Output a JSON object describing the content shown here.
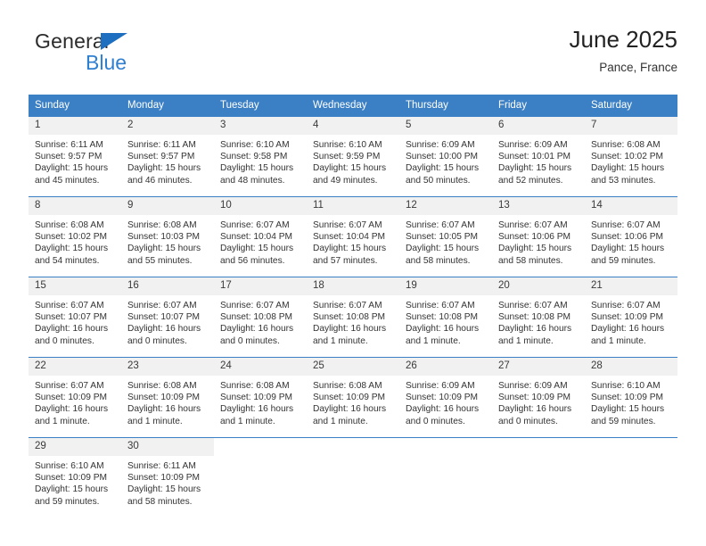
{
  "brand": {
    "name_part1": "General",
    "name_part2": "Blue",
    "triangle_color": "#1f6fc0",
    "blue_color": "#2f7fd1"
  },
  "header": {
    "title": "June 2025",
    "subtitle": "Pance, France"
  },
  "theme": {
    "header_row_bg": "#3b7fc4",
    "daynum_bg": "#f1f1f1",
    "cell_border": "#3b7fc4",
    "text": "#333333"
  },
  "calendar": {
    "weekday_headers": [
      "Sunday",
      "Monday",
      "Tuesday",
      "Wednesday",
      "Thursday",
      "Friday",
      "Saturday"
    ],
    "weeks": [
      [
        {
          "day": "1",
          "sunrise": "Sunrise: 6:11 AM",
          "sunset": "Sunset: 9:57 PM",
          "daylight": "Daylight: 15 hours and 45 minutes."
        },
        {
          "day": "2",
          "sunrise": "Sunrise: 6:11 AM",
          "sunset": "Sunset: 9:57 PM",
          "daylight": "Daylight: 15 hours and 46 minutes."
        },
        {
          "day": "3",
          "sunrise": "Sunrise: 6:10 AM",
          "sunset": "Sunset: 9:58 PM",
          "daylight": "Daylight: 15 hours and 48 minutes."
        },
        {
          "day": "4",
          "sunrise": "Sunrise: 6:10 AM",
          "sunset": "Sunset: 9:59 PM",
          "daylight": "Daylight: 15 hours and 49 minutes."
        },
        {
          "day": "5",
          "sunrise": "Sunrise: 6:09 AM",
          "sunset": "Sunset: 10:00 PM",
          "daylight": "Daylight: 15 hours and 50 minutes."
        },
        {
          "day": "6",
          "sunrise": "Sunrise: 6:09 AM",
          "sunset": "Sunset: 10:01 PM",
          "daylight": "Daylight: 15 hours and 52 minutes."
        },
        {
          "day": "7",
          "sunrise": "Sunrise: 6:08 AM",
          "sunset": "Sunset: 10:02 PM",
          "daylight": "Daylight: 15 hours and 53 minutes."
        }
      ],
      [
        {
          "day": "8",
          "sunrise": "Sunrise: 6:08 AM",
          "sunset": "Sunset: 10:02 PM",
          "daylight": "Daylight: 15 hours and 54 minutes."
        },
        {
          "day": "9",
          "sunrise": "Sunrise: 6:08 AM",
          "sunset": "Sunset: 10:03 PM",
          "daylight": "Daylight: 15 hours and 55 minutes."
        },
        {
          "day": "10",
          "sunrise": "Sunrise: 6:07 AM",
          "sunset": "Sunset: 10:04 PM",
          "daylight": "Daylight: 15 hours and 56 minutes."
        },
        {
          "day": "11",
          "sunrise": "Sunrise: 6:07 AM",
          "sunset": "Sunset: 10:04 PM",
          "daylight": "Daylight: 15 hours and 57 minutes."
        },
        {
          "day": "12",
          "sunrise": "Sunrise: 6:07 AM",
          "sunset": "Sunset: 10:05 PM",
          "daylight": "Daylight: 15 hours and 58 minutes."
        },
        {
          "day": "13",
          "sunrise": "Sunrise: 6:07 AM",
          "sunset": "Sunset: 10:06 PM",
          "daylight": "Daylight: 15 hours and 58 minutes."
        },
        {
          "day": "14",
          "sunrise": "Sunrise: 6:07 AM",
          "sunset": "Sunset: 10:06 PM",
          "daylight": "Daylight: 15 hours and 59 minutes."
        }
      ],
      [
        {
          "day": "15",
          "sunrise": "Sunrise: 6:07 AM",
          "sunset": "Sunset: 10:07 PM",
          "daylight": "Daylight: 16 hours and 0 minutes."
        },
        {
          "day": "16",
          "sunrise": "Sunrise: 6:07 AM",
          "sunset": "Sunset: 10:07 PM",
          "daylight": "Daylight: 16 hours and 0 minutes."
        },
        {
          "day": "17",
          "sunrise": "Sunrise: 6:07 AM",
          "sunset": "Sunset: 10:08 PM",
          "daylight": "Daylight: 16 hours and 0 minutes."
        },
        {
          "day": "18",
          "sunrise": "Sunrise: 6:07 AM",
          "sunset": "Sunset: 10:08 PM",
          "daylight": "Daylight: 16 hours and 1 minute."
        },
        {
          "day": "19",
          "sunrise": "Sunrise: 6:07 AM",
          "sunset": "Sunset: 10:08 PM",
          "daylight": "Daylight: 16 hours and 1 minute."
        },
        {
          "day": "20",
          "sunrise": "Sunrise: 6:07 AM",
          "sunset": "Sunset: 10:08 PM",
          "daylight": "Daylight: 16 hours and 1 minute."
        },
        {
          "day": "21",
          "sunrise": "Sunrise: 6:07 AM",
          "sunset": "Sunset: 10:09 PM",
          "daylight": "Daylight: 16 hours and 1 minute."
        }
      ],
      [
        {
          "day": "22",
          "sunrise": "Sunrise: 6:07 AM",
          "sunset": "Sunset: 10:09 PM",
          "daylight": "Daylight: 16 hours and 1 minute."
        },
        {
          "day": "23",
          "sunrise": "Sunrise: 6:08 AM",
          "sunset": "Sunset: 10:09 PM",
          "daylight": "Daylight: 16 hours and 1 minute."
        },
        {
          "day": "24",
          "sunrise": "Sunrise: 6:08 AM",
          "sunset": "Sunset: 10:09 PM",
          "daylight": "Daylight: 16 hours and 1 minute."
        },
        {
          "day": "25",
          "sunrise": "Sunrise: 6:08 AM",
          "sunset": "Sunset: 10:09 PM",
          "daylight": "Daylight: 16 hours and 1 minute."
        },
        {
          "day": "26",
          "sunrise": "Sunrise: 6:09 AM",
          "sunset": "Sunset: 10:09 PM",
          "daylight": "Daylight: 16 hours and 0 minutes."
        },
        {
          "day": "27",
          "sunrise": "Sunrise: 6:09 AM",
          "sunset": "Sunset: 10:09 PM",
          "daylight": "Daylight: 16 hours and 0 minutes."
        },
        {
          "day": "28",
          "sunrise": "Sunrise: 6:10 AM",
          "sunset": "Sunset: 10:09 PM",
          "daylight": "Daylight: 15 hours and 59 minutes."
        }
      ],
      [
        {
          "day": "29",
          "sunrise": "Sunrise: 6:10 AM",
          "sunset": "Sunset: 10:09 PM",
          "daylight": "Daylight: 15 hours and 59 minutes."
        },
        {
          "day": "30",
          "sunrise": "Sunrise: 6:11 AM",
          "sunset": "Sunset: 10:09 PM",
          "daylight": "Daylight: 15 hours and 58 minutes."
        },
        null,
        null,
        null,
        null,
        null
      ]
    ]
  }
}
